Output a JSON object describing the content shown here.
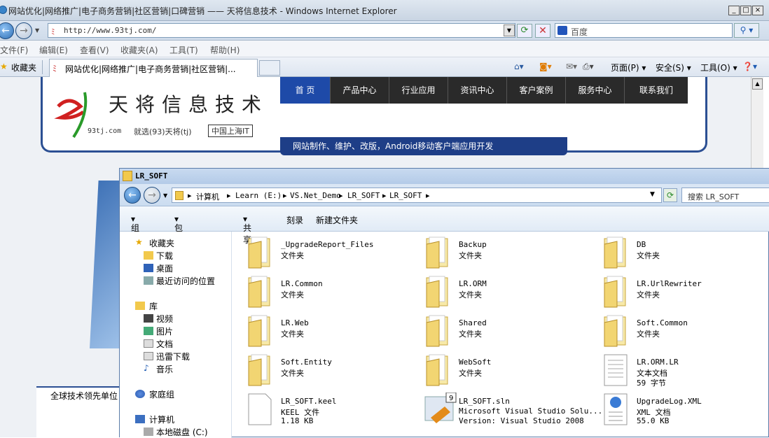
{
  "ie": {
    "title": "网站优化|网络推广|电子商务营销|社区营销|口碑营销 —— 天将信息技术 - Windows Internet Explorer",
    "url": "http://www.93tj.com/",
    "search_placeholder": "百度",
    "menu": [
      "文件(F)",
      "编辑(E)",
      "查看(V)",
      "收藏夹(A)",
      "工具(T)",
      "帮助(H)"
    ],
    "favorites": "收藏夹",
    "tab": "网站优化|网络推广|电子商务营销|社区营销|...",
    "cmd_page": "页面(P)",
    "cmd_safety": "安全(S)",
    "cmd_tools": "工具(O)"
  },
  "site": {
    "logo_text": "天将信息技术",
    "domain": "93tj.com",
    "tagline": "就选(93)天将(tj)",
    "location": "中国上海IT",
    "nav": [
      "首 页",
      "产品中心",
      "行业应用",
      "资讯中心",
      "客户案例",
      "服务中心",
      "联系我们"
    ],
    "slogan": "网站制作、维护、改版，Android移动客户端应用开发",
    "left_box": "全球技术领先单位"
  },
  "explorer": {
    "title": "LR_SOFT",
    "breadcrumb": [
      "计算机",
      "Learn (E:)",
      "VS.Net_Demo",
      "LR_SOFT",
      "LR_SOFT"
    ],
    "search": "搜索 LR_SOFT",
    "toolbar": [
      "组织",
      "包含到库中",
      "共享",
      "刻录",
      "新建文件夹"
    ],
    "nav": {
      "favorites": "收藏夹",
      "fav_items": [
        "下载",
        "桌面",
        "最近访问的位置"
      ],
      "libraries": "库",
      "lib_items": [
        "视频",
        "图片",
        "文档",
        "迅雷下载",
        "音乐"
      ],
      "homegroup": "家庭组",
      "computer": "计算机",
      "drive": "本地磁盘 (C:)"
    },
    "files": [
      {
        "name": "_UpgradeReport_Files",
        "d1": "文件夹",
        "d2": "",
        "icon": "folder-icon"
      },
      {
        "name": "Backup",
        "d1": "文件夹",
        "d2": "",
        "icon": "folder-icon"
      },
      {
        "name": "DB",
        "d1": "文件夹",
        "d2": "",
        "icon": "folder-icon"
      },
      {
        "name": "LR.Common",
        "d1": "文件夹",
        "d2": "",
        "icon": "folder-icon"
      },
      {
        "name": "LR.ORM",
        "d1": "文件夹",
        "d2": "",
        "icon": "folder-icon"
      },
      {
        "name": "LR.UrlRewriter",
        "d1": "文件夹",
        "d2": "",
        "icon": "folder-icon"
      },
      {
        "name": "LR.Web",
        "d1": "文件夹",
        "d2": "",
        "icon": "folder-icon"
      },
      {
        "name": "Shared",
        "d1": "文件夹",
        "d2": "",
        "icon": "folder-icon"
      },
      {
        "name": "Soft.Common",
        "d1": "文件夹",
        "d2": "",
        "icon": "folder-icon"
      },
      {
        "name": "Soft.Entity",
        "d1": "文件夹",
        "d2": "",
        "icon": "folder-icon"
      },
      {
        "name": "WebSoft",
        "d1": "文件夹",
        "d2": "",
        "icon": "folder-icon"
      },
      {
        "name": "LR.ORM.LR",
        "d1": "文本文档",
        "d2": "59 字节",
        "icon": "text-file-icon"
      },
      {
        "name": "LR_SOFT.keel",
        "d1": "KEEL 文件",
        "d2": "1.18 KB",
        "icon": "file-icon"
      },
      {
        "name": "LR_SOFT.sln",
        "d1": "Microsoft Visual Studio Solu...",
        "d2": "Version: Visual Studio 2008",
        "icon": "solution-file-icon"
      },
      {
        "name": "UpgradeLog.XML",
        "d1": "XML 文档",
        "d2": "55.0 KB",
        "icon": "xml-file-icon"
      }
    ]
  }
}
